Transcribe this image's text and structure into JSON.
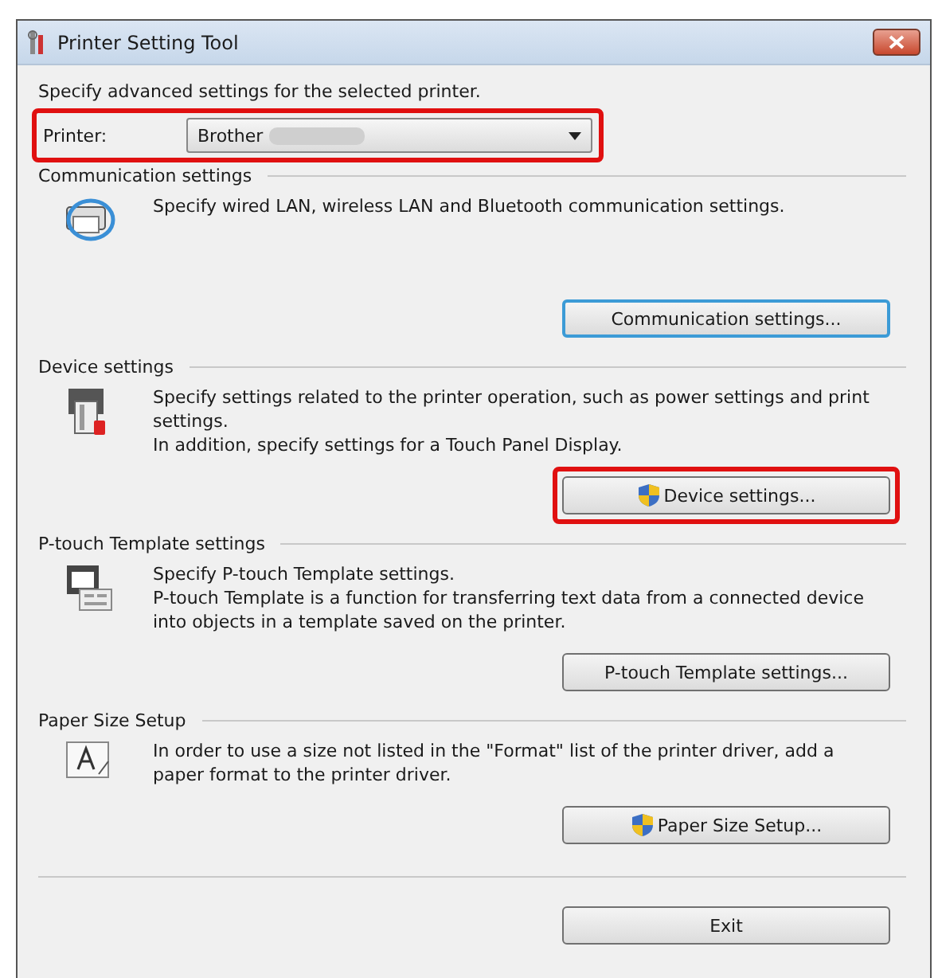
{
  "window": {
    "title": "Printer Setting Tool"
  },
  "intro": "Specify advanced settings for the selected printer.",
  "printer": {
    "label": "Printer:",
    "value": "Brother",
    "redacted": true,
    "highlighted": true
  },
  "sections": [
    {
      "title": "Communication settings",
      "kind": "network",
      "text": [
        "Specify wired LAN, wireless LAN and Bluetooth communication settings."
      ],
      "button": {
        "label": "Communication settings...",
        "shield": false,
        "focused": true,
        "highlighted": false
      }
    },
    {
      "title": "Device settings",
      "kind": "tools",
      "text": [
        "Specify settings related to the printer operation, such as power settings and print settings.",
        "In addition, specify settings for a Touch Panel Display."
      ],
      "button": {
        "label": "Device settings...",
        "shield": true,
        "focused": false,
        "highlighted": true
      }
    },
    {
      "title": "P-touch Template settings",
      "kind": "template",
      "text": [
        "Specify P-touch Template settings.",
        "P-touch Template is a function for transferring text data from a connected device into objects in a template saved on the printer."
      ],
      "button": {
        "label": "P-touch Template settings...",
        "shield": false,
        "focused": false,
        "highlighted": false
      }
    },
    {
      "title": "Paper Size Setup",
      "kind": "paper",
      "text": [
        "In order to use a size not listed in the \"Format\" list of the printer driver, add a paper format to the printer driver."
      ],
      "button": {
        "label": "Paper Size Setup...",
        "shield": true,
        "focused": false,
        "highlighted": false
      }
    }
  ],
  "exit_button": "Exit"
}
